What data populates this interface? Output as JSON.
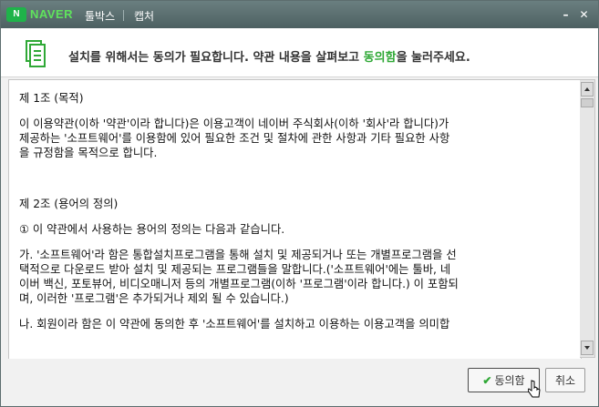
{
  "window": {
    "logo_text": "N",
    "brand": "NAVER",
    "app_name": "툴박스",
    "title": "캡처",
    "minimize_label": "–",
    "close_label": "✕"
  },
  "header": {
    "text_before": "설치를 위해서는 동의가 필요합니다. 약관 내용을 살펴보고 ",
    "highlight": "동의함",
    "text_after": "을 눌러주세요."
  },
  "terms": {
    "paragraphs": [
      "제 1조 (목적)",
      "이 이용약관(이하 '약관'이라 합니다)은 이용고객이 네이버 주식회사(이하 '회사'라 합니다)가\n제공하는 '소프트웨어'를 이용함에 있어 필요한 조건 및 절차에 관한 사항과 기타 필요한 사항\n을 규정함을 목적으로 합니다.",
      "제 2조 (용어의 정의)",
      "① 이 약관에서 사용하는 용어의 정의는 다음과 같습니다.",
      "가. '소프트웨어'라 함은 통합설치프로그램을 통해 설치 및 제공되거나 또는 개별프로그램을 선\n택적으로 다운로드 받아 설치 및 제공되는 프로그램들을 말합니다.('소프트웨어'에는 툴바, 네\n이버 백신, 포토뷰어, 비디오매니저 등의 개별프로그램(이하 '프로그램'이라 합니다.) 이 포함되\n며, 이러한 '프로그램'은 추가되거나 제외 될 수 있습니다.)",
      "나. 회원이라 함은 이 약관에 동의한 후 '소프트웨어'를 설치하고 이용하는 이용고객을 의미합"
    ]
  },
  "footer": {
    "agree_label": "동의함",
    "cancel_label": "취소"
  }
}
